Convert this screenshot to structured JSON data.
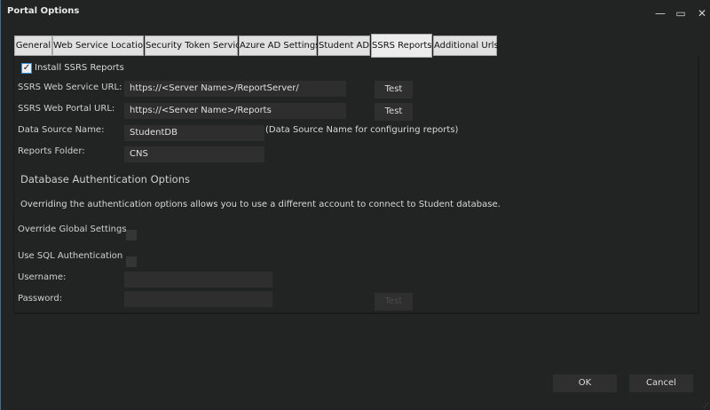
{
  "window": {
    "title": "Portal Options",
    "minimize": "—",
    "maximize": "▭",
    "close": "✕"
  },
  "tabs": [
    {
      "label": "General"
    },
    {
      "label": "Web Service Location"
    },
    {
      "label": "Security Token Service"
    },
    {
      "label": "Azure AD Settings"
    },
    {
      "label": "Student AD"
    },
    {
      "label": "SSRS Reports",
      "selected": true
    },
    {
      "label": "Additional Urls"
    }
  ],
  "ssrs": {
    "install_label": "Install SSRS Reports",
    "install_checked": true,
    "web_service_url_label": "SSRS Web Service URL:",
    "web_service_url": "https://<Server Name>/ReportServer/",
    "web_portal_url_label": "SSRS Web Portal URL:",
    "web_portal_url": "https://<Server Name>/Reports",
    "test_label": "Test",
    "data_source_label": "Data Source Name:",
    "data_source": "StudentDB",
    "data_source_hint": "(Data Source Name for configuring reports)",
    "reports_folder_label": "Reports Folder:",
    "reports_folder": "CNS"
  },
  "auth": {
    "heading": "Database Authentication Options",
    "description": "Overriding the authentication options allows you to use a different account to connect to Student database.",
    "override_label": "Override Global Settings",
    "sql_auth_label": "Use SQL Authentication",
    "username_label": "Username:",
    "username": "",
    "password_label": "Password:",
    "password": "",
    "test_label": "Test"
  },
  "footer": {
    "ok": "OK",
    "cancel": "Cancel"
  }
}
